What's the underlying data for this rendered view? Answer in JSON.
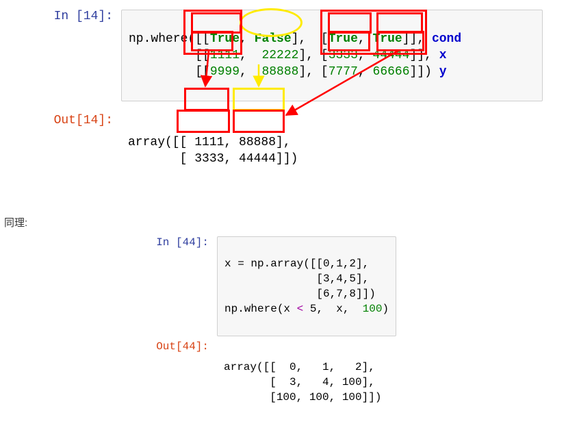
{
  "cell1": {
    "in_prompt": "In  [14]:",
    "out_prompt": "Out[14]:",
    "line1_pre": "np.where([[",
    "true1": "True",
    "sep1": ", ",
    "false1": "False",
    "mid1": "],  [",
    "true2": "True",
    "sep2": ", ",
    "true3": "True",
    "end1": "]],",
    "ann1": " cond",
    "line2_pre": "         [[",
    "n1111": "1111",
    "c2a": ",  ",
    "n22222": "22222",
    "mid2": "], [",
    "n3333": "3333",
    "c2b": ", ",
    "n44444": "44444",
    "end2": "]],",
    "ann2": " x",
    "line3_pre": "         [[",
    "n9999": "9999",
    "c3a": ",  ",
    "n88888": "88888",
    "mid3": "], [",
    "n7777": "7777",
    "c3b": ", ",
    "n66666": "66666",
    "end3": "]])",
    "ann3": " y",
    "out_line1": "array([[ 1111, 88888],",
    "out_line2": "       [ 3333, 44444]])"
  },
  "mid_text": "同理:",
  "cell2": {
    "in_prompt": "In  [44]:",
    "out_prompt": "Out[44]:",
    "in_l1": "x = np.array([[0,1,2],",
    "in_l2": "              [3,4,5],",
    "in_l3": "              [6,7,8]])",
    "in_l4_a": "np.where(x ",
    "in_l4_op": "<",
    "in_l4_b": " 5,  x,  ",
    "in_l4_c": "100",
    "in_l4_d": ")",
    "out_l1": "array([[  0,   1,   2],",
    "out_l2": "       [  3,   4, 100],",
    "out_l3": "       [100, 100, 100]])"
  }
}
